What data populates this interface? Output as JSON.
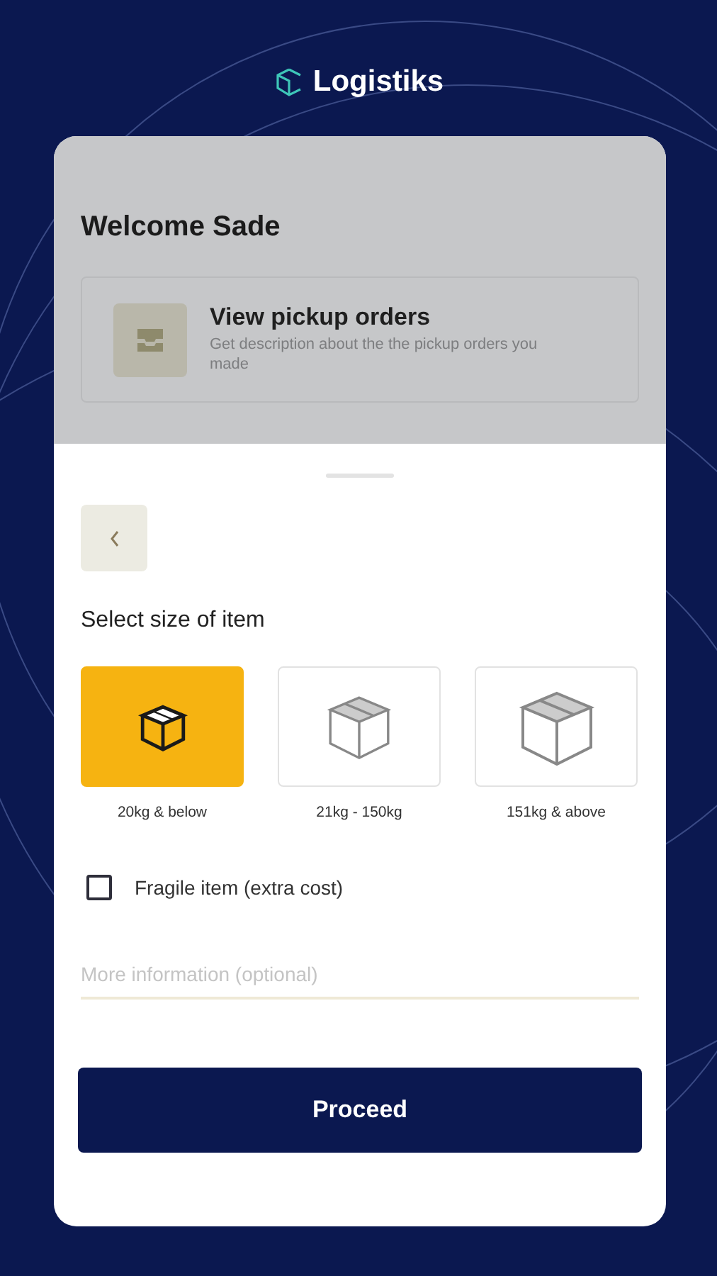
{
  "app": {
    "logo": "Logistiks"
  },
  "dashboard": {
    "greeting": "Welcome Sade",
    "card": {
      "title": "View pickup orders",
      "description": "Get description about the the pickup orders you made"
    }
  },
  "sheet": {
    "heading": "Select size of item",
    "sizes": [
      {
        "kind": "small",
        "label": "20kg & below",
        "selected": true
      },
      {
        "kind": "medium",
        "label": "21kg - 150kg",
        "selected": false
      },
      {
        "kind": "large",
        "label": "151kg & above",
        "selected": false
      }
    ],
    "fragile": {
      "label": "Fragile item (extra cost)",
      "checked": false
    },
    "info_field": {
      "placeholder": "More information (optional)"
    },
    "proceed_button": "Proceed"
  }
}
